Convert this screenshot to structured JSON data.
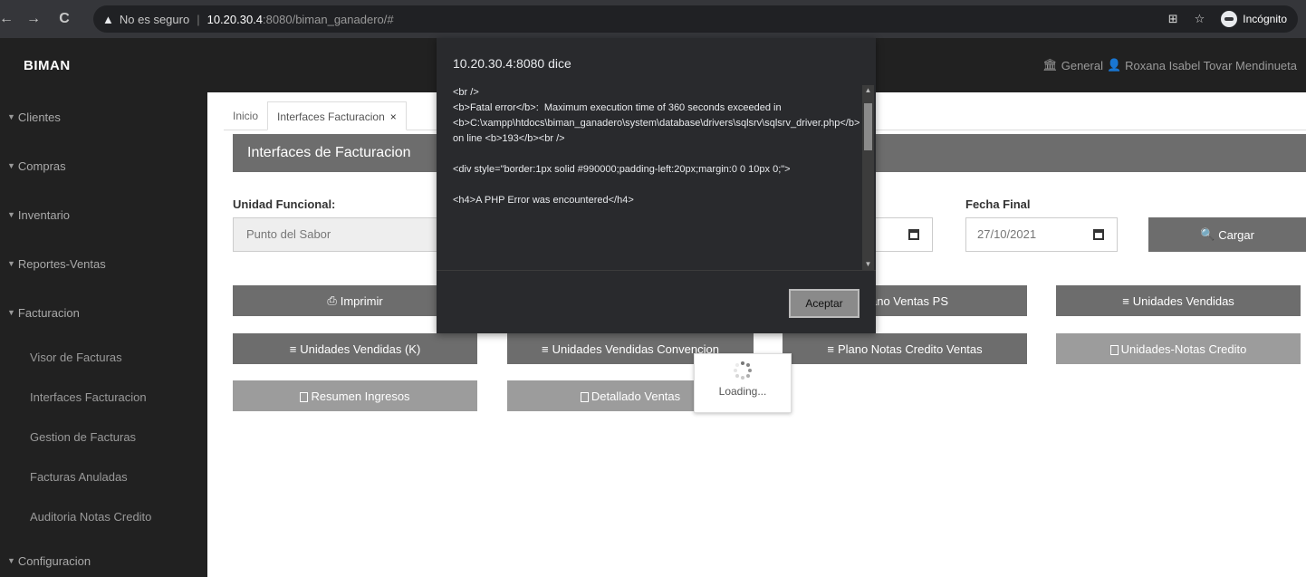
{
  "browser": {
    "not_secure": "No es seguro",
    "url_host": "10.20.30.4",
    "url_rest": ":8080/biman_ganadero/#",
    "incognito": "Incógnito"
  },
  "app": {
    "brand": "BIMAN",
    "user_branch": "General",
    "user_name": "Roxana Isabel Tovar Mendinueta"
  },
  "sidebar": {
    "items": [
      {
        "label": "Clientes"
      },
      {
        "label": "Compras"
      },
      {
        "label": "Inventario"
      },
      {
        "label": "Reportes-Ventas"
      },
      {
        "label": "Facturacion"
      }
    ],
    "sub_items": [
      {
        "label": "Visor de Facturas"
      },
      {
        "label": "Interfaces Facturacion"
      },
      {
        "label": "Gestion de Facturas"
      },
      {
        "label": "Facturas Anuladas"
      },
      {
        "label": "Auditoria Notas Credito"
      }
    ],
    "last_item": "Configuracion"
  },
  "tabs": [
    {
      "label": "Inicio"
    },
    {
      "label": "Interfaces Facturacion"
    }
  ],
  "page_title": "Interfaces de Facturacion",
  "form": {
    "unidad_label": "Unidad Funcional:",
    "unidad_value": "Punto del Sabor",
    "fecha_final_label": "Fecha Final",
    "fecha_final_value": "27/10/2021",
    "cargar": "Cargar"
  },
  "buttons": {
    "imprimir": "Imprimir",
    "plano_ventas_ps": "ano Ventas PS",
    "unidades_vendidas": "Unidades Vendidas",
    "unidades_vendidas_k": "Unidades Vendidas (K)",
    "unidades_vendidas_conv": "Unidades Vendidas Convencion",
    "plano_notas": "Plano Notas Credito Ventas",
    "unidades_notas": "Unidades-Notas Credito",
    "resumen_ingresos": "Resumen Ingresos",
    "detallado_ventas": "Detallado Ventas"
  },
  "loading": "Loading...",
  "dialog": {
    "title": "10.20.30.4:8080 dice",
    "lines": [
      "<br />\n<b>Fatal error</b>:  Maximum execution time of 360 seconds exceeded in <b>C:\\xampp\\htdocs\\biman_ganadero\\system\\database\\drivers\\sqlsrv\\sqlsrv_driver.php</b> on line <b>193</b><br />",
      "<div style=\"border:1px solid #990000;padding-left:20px;margin:0 0 10px 0;\">",
      "<h4>A PHP Error was encountered</h4>"
    ],
    "ok": "Aceptar"
  }
}
